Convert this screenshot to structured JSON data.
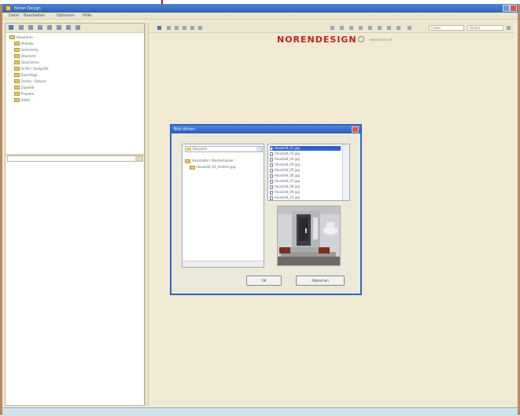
{
  "window": {
    "title": "Noren Design",
    "menus": [
      "Datei",
      "Bearbeiten",
      "Optionen",
      "Hilfe"
    ]
  },
  "left_tree": {
    "items": [
      {
        "label": "Haustüren"
      },
      {
        "label": "Modelle"
      },
      {
        "label": "Seitenteile"
      },
      {
        "label": "Oberlicht"
      },
      {
        "label": "Glasmotive"
      },
      {
        "label": "Griffe / Stoßgriffe"
      },
      {
        "label": "Beschläge"
      },
      {
        "label": "Farben / Dekore"
      },
      {
        "label": "Zubehör"
      },
      {
        "label": "Projekte"
      },
      {
        "label": "Bilder"
      }
    ]
  },
  "right_toolbar": {
    "field1": "Laden",
    "field2": "Objekt"
  },
  "brand": {
    "logo_text": "NORENDESIGN",
    "sub_text": "www.noren.de"
  },
  "dialog": {
    "title": "Bild öffnen",
    "combo_value": "Beispiele",
    "tree_items": [
      "Hausbilder / Musterhäuser",
      "Hausbild_01_modern.jpg"
    ],
    "files": [
      "Hausbild_01.jpg",
      "Hausbild_02.jpg",
      "Hausbild_03.jpg",
      "Hausbild_04.jpg",
      "Hausbild_05.jpg",
      "Hausbild_06.jpg",
      "Hausbild_07.jpg",
      "Hausbild_08.jpg",
      "Hausbild_09.jpg",
      "Hausbild_10.jpg"
    ],
    "selected_index": 0,
    "ok_label": "OK",
    "cancel_label": "Abbrechen"
  },
  "colors": {
    "brand_red": "#c4211c",
    "title_blue": "#2f63b2",
    "selection_blue": "#3163c5",
    "pointer_red": "#b01818"
  }
}
